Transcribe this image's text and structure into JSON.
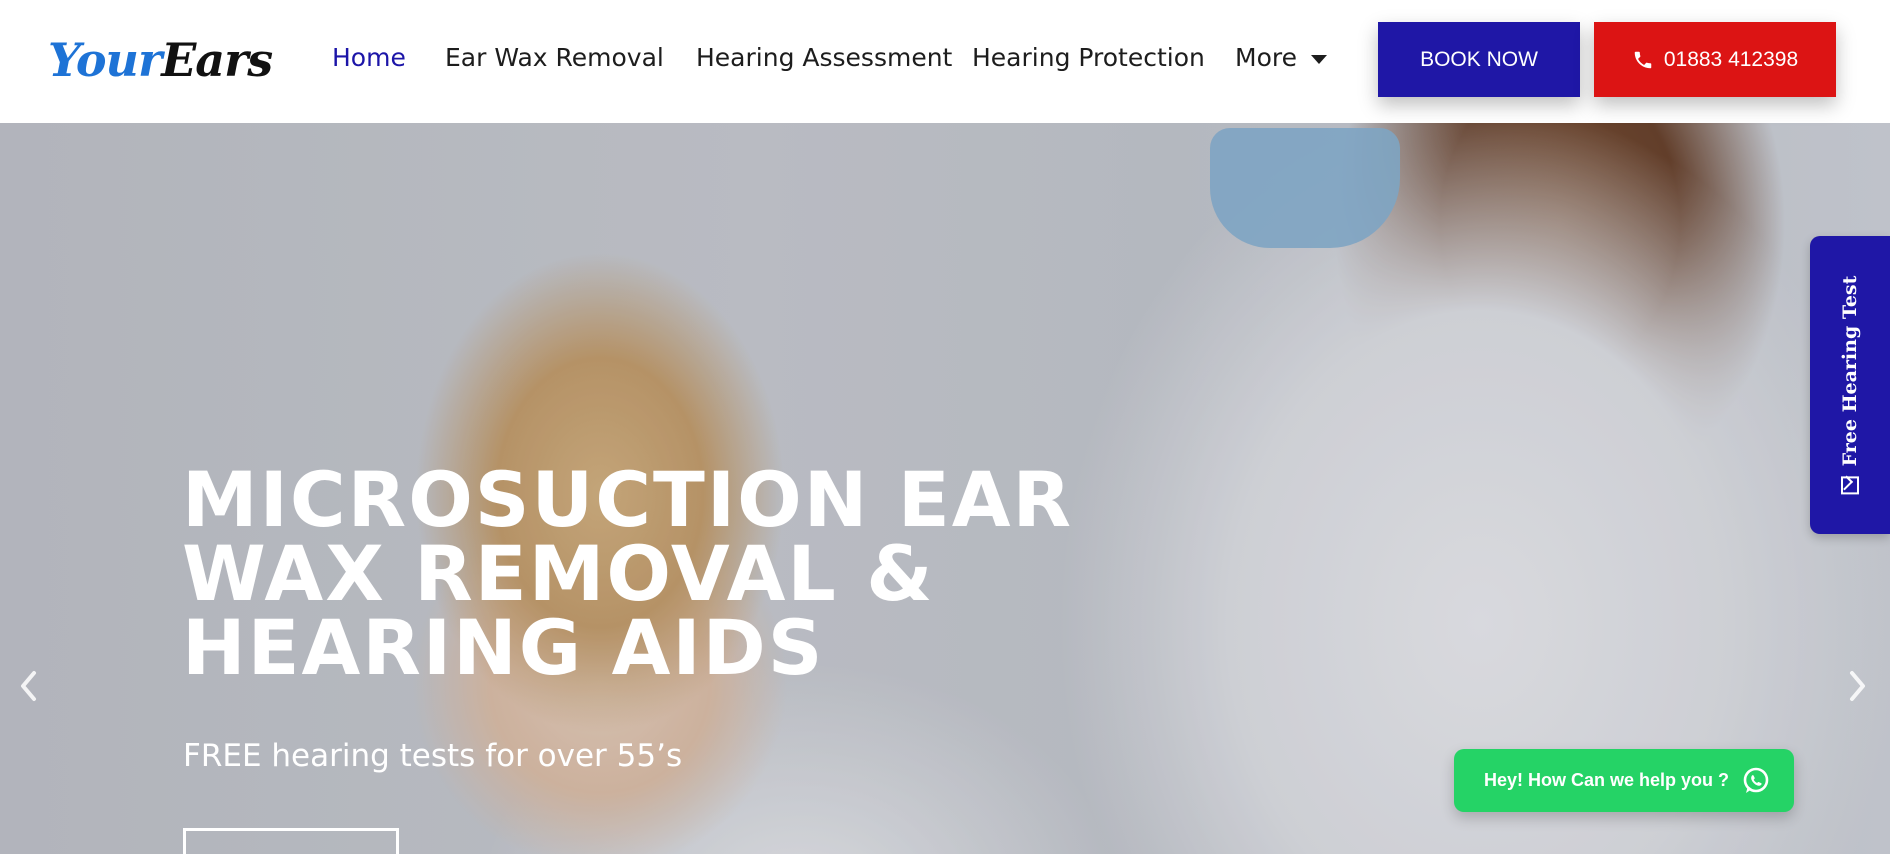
{
  "header": {
    "logo": {
      "part1": "Your",
      "part2": "Ears"
    },
    "nav": [
      {
        "label": "Home",
        "active": true
      },
      {
        "label": "Ear Wax Removal",
        "active": false
      },
      {
        "label": "Hearing Assessment",
        "active": false
      },
      {
        "label": "Hearing Protection",
        "active": false
      },
      {
        "label": "More",
        "active": false,
        "has_dropdown": true
      }
    ],
    "book_button": "BOOK NOW",
    "phone_button": {
      "label": "01883 412398",
      "icon": "phone-icon"
    }
  },
  "hero": {
    "title": "MICROSUCTION EAR WAX REMOVAL & HEARING AIDS",
    "subtitle": "FREE hearing tests for over 55’s",
    "prev_icon": "chevron-left-icon",
    "next_icon": "chevron-right-icon"
  },
  "side_tab": {
    "label": "Free Hearing Test",
    "icon": "mail-icon"
  },
  "chat": {
    "label": "Hey! How Can we help you ?",
    "icon": "whatsapp-icon"
  },
  "colors": {
    "accent_blue": "#1f17a6",
    "accent_red": "#dc1414",
    "whatsapp_green": "#25d366",
    "logo_blue": "#1e73d6"
  }
}
